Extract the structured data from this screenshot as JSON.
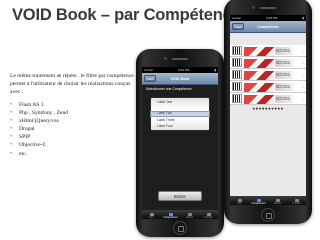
{
  "slide": {
    "title": "VOID Book – par Compétences",
    "intro": "Le même traitement ae répète . le filtre par compétence  permet à l'utilisateur de choisir les réalisations conçus avec :",
    "bullets": [
      "Flash AS 3",
      "Php , Symfony , Zend",
      "xHtml/jQuery/css",
      "Drupal",
      "SPIP",
      "Objective-C",
      "etc."
    ]
  },
  "phone1": {
    "carrier": "Carrier",
    "time": "9:45 PM",
    "back_label": "Back",
    "nav_title": "VOID Book",
    "prompt": "Sélectionner  une Compétence",
    "picker_items": [
      "Label One",
      "Label Two",
      "Label Three",
      "Label Four"
    ],
    "selected_index": 1,
    "check": "✓",
    "enter_label": "Entrer",
    "tabs": [
      "Dev",
      "Compétences",
      "Clients",
      "Contact"
    ],
    "active_tab": 1
  },
  "phone2": {
    "carrier": "Carrier",
    "time": "9:45 PM",
    "back_label": "Back",
    "nav_title": "Compétence",
    "row_text": "Lorem ipsum dolor sit amet",
    "row_count": 5,
    "arrow": "›",
    "pager_dots": "●●●●●●●●●●",
    "tabs": [
      "Dev",
      "Compétences",
      "Clients",
      "Contact"
    ],
    "active_tab": 1
  },
  "colors": {
    "title": "#3a3a3a",
    "navbar_top": "#a4b6ce",
    "navbar_bottom": "#6f88ac",
    "selected_tab": "#4a9cf0",
    "picker_band": "#a0afd7"
  }
}
